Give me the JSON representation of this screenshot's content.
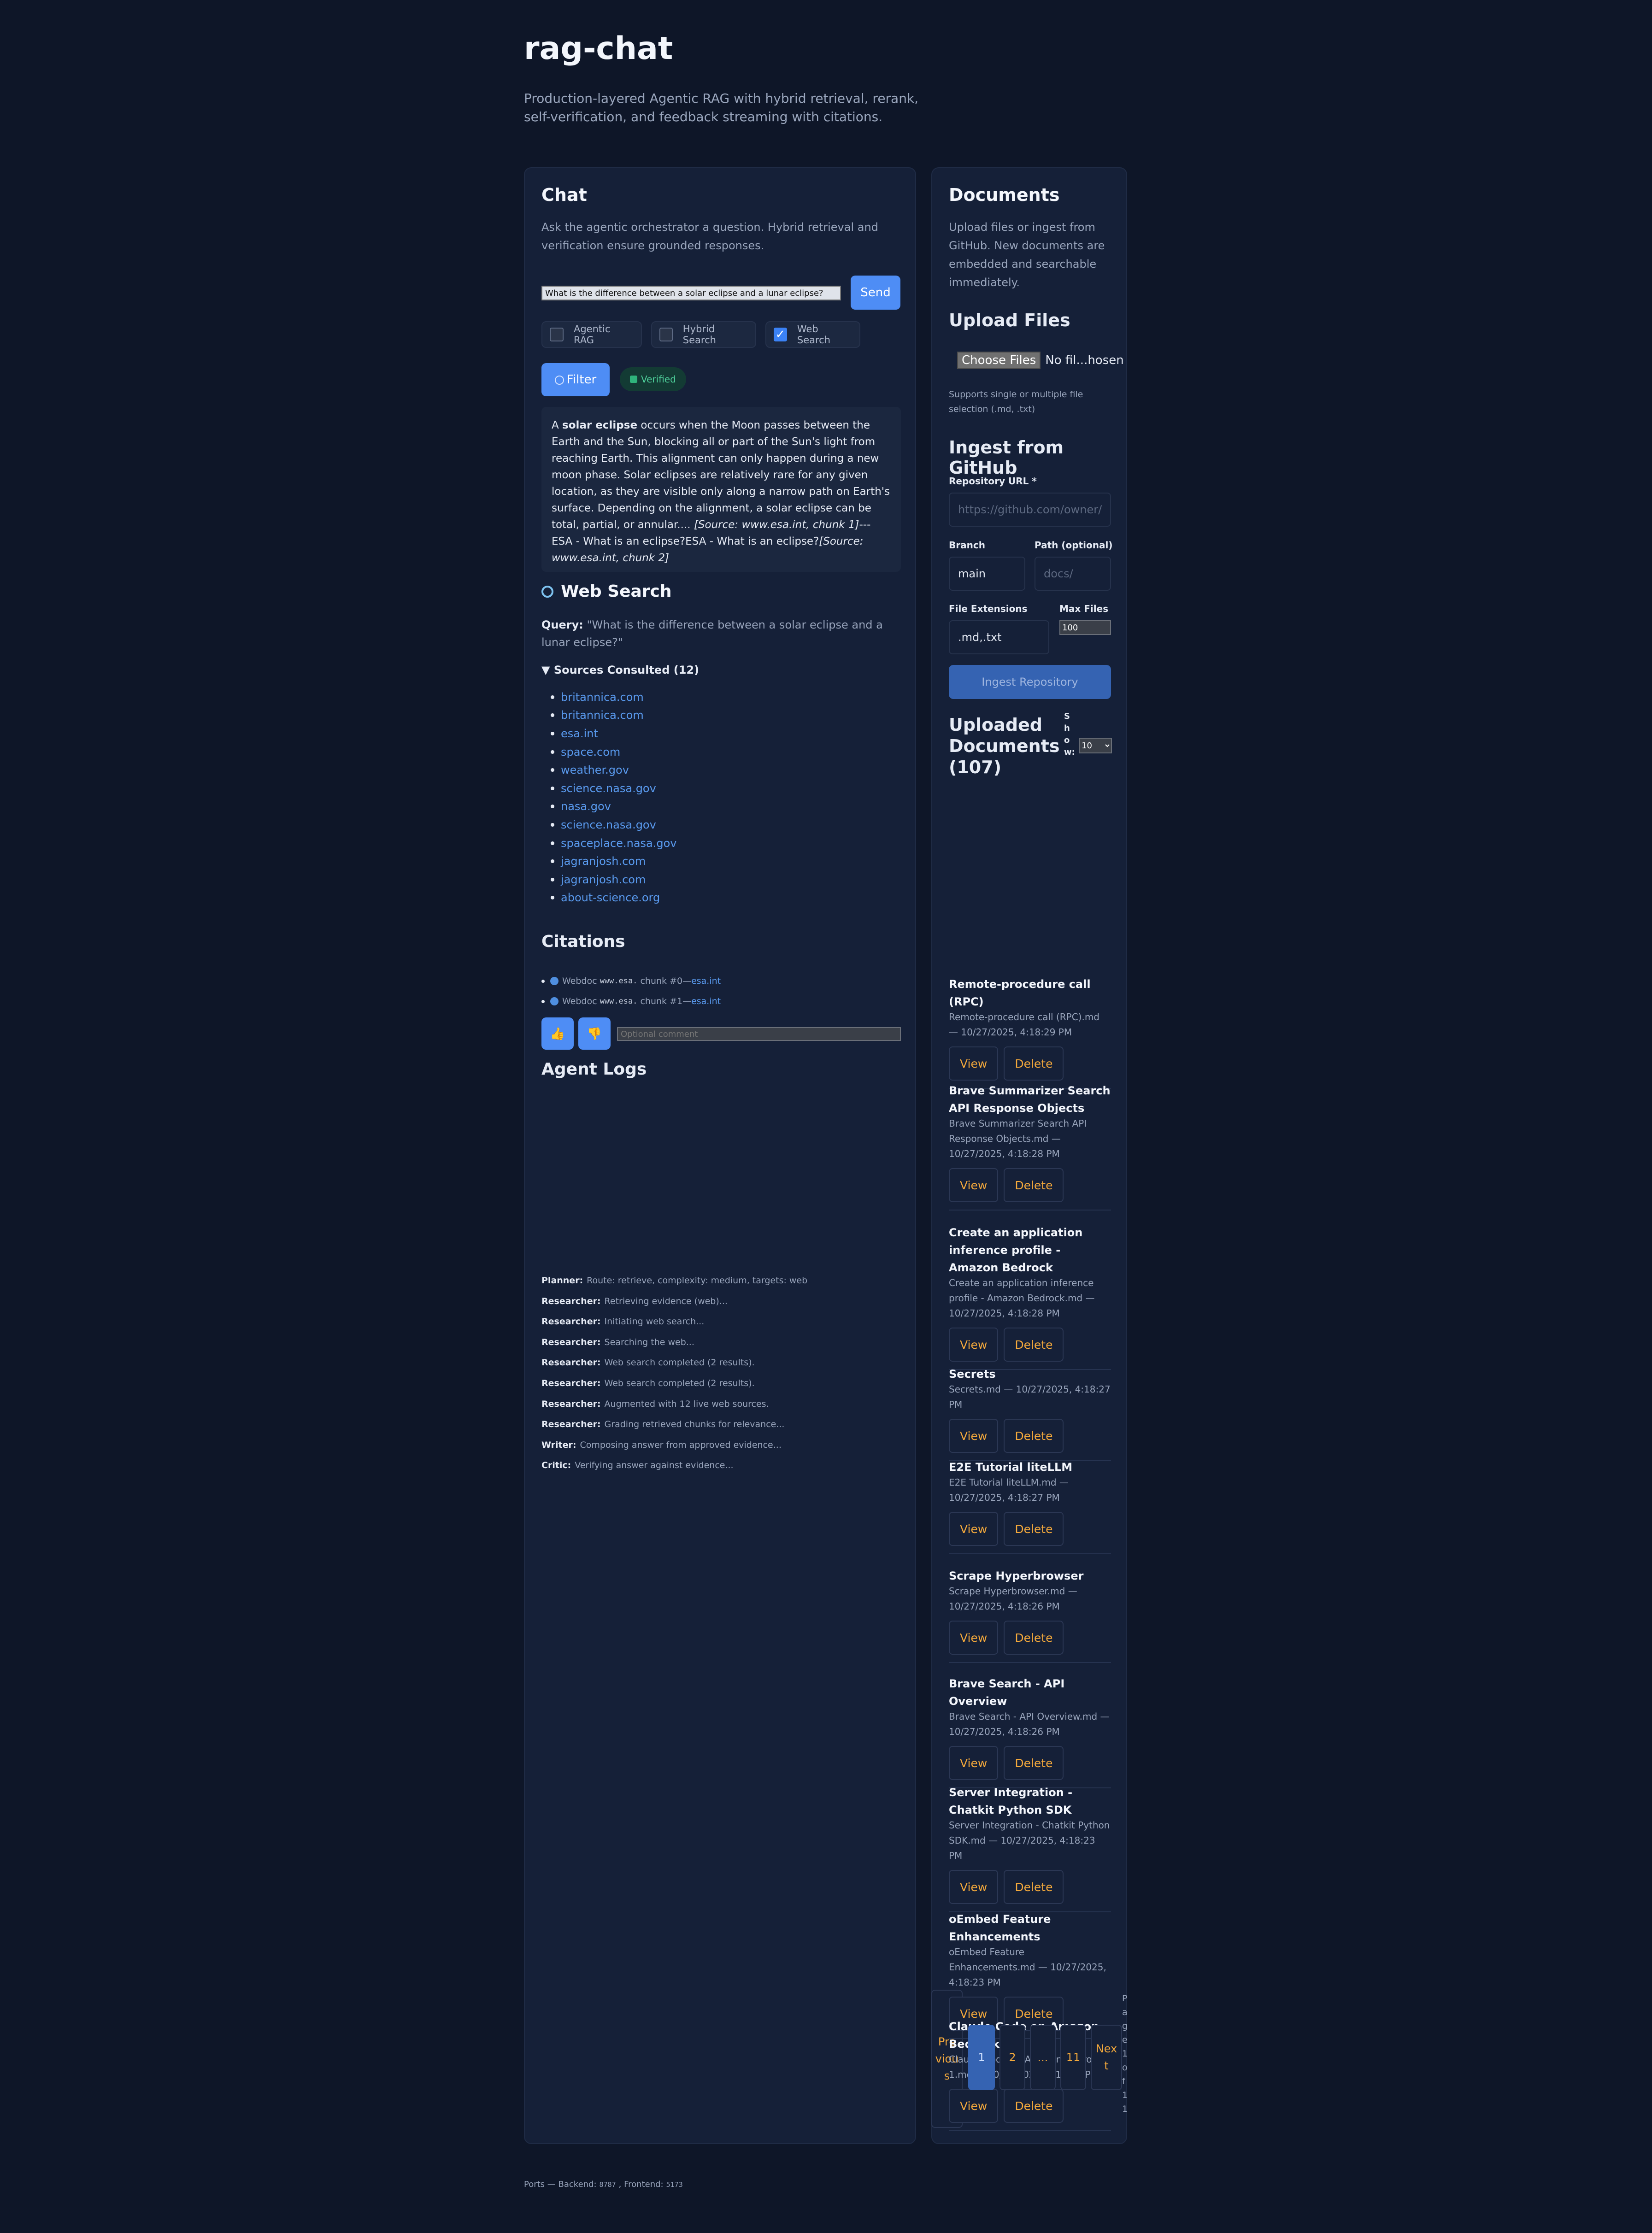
{
  "app": {
    "title": "rag-chat",
    "subtitle": "Production-layered Agentic RAG with hybrid retrieval, rerank, self-verification, and feedback streaming with citations."
  },
  "chat": {
    "heading": "Chat",
    "description": "Ask the agentic orchestrator a question. Hybrid retrieval and verification ensure grounded responses.",
    "query_value": "What is the difference between a solar eclipse and a lunar eclipse?",
    "send_label": "Send",
    "toggles": [
      {
        "label": "Agentic RAG",
        "checked": false
      },
      {
        "label": "Hybrid Search",
        "checked": false
      },
      {
        "label": "Web Search",
        "checked": true
      }
    ],
    "filter_label": "Filter",
    "verified_label": "Verified",
    "answer": {
      "prefix": "A ",
      "bold": "solar eclipse",
      "body": " occurs when the Moon passes between the Earth and the Sun, blocking all or part of the Sun's light from reaching Earth. This alignment can only happen during a new moon phase. Solar eclipses are relatively rare for any given location, as they are visible only along a narrow path on Earth's surface. Depending on the alignment, a solar eclipse can be total, partial, or annular....",
      "cite1": "[Source: www.esa.int, chunk 1]",
      "mid": "---ESA - What is an eclipse?ESA - What is an eclipse?",
      "cite2": "[Source: www.esa.int, chunk 2]"
    }
  },
  "web_search": {
    "heading": "Web Search",
    "query_label": "Query:",
    "query_text": "\"What is the difference between a solar eclipse and a lunar eclipse?\"",
    "sources_summary": "▼ Sources Consulted (12)",
    "sources": [
      "britannica.com",
      "britannica.com",
      "esa.int",
      "space.com",
      "weather.gov",
      "science.nasa.gov",
      "nasa.gov",
      "science.nasa.gov",
      "spaceplace.nasa.gov",
      "jagranjosh.com",
      "jagranjosh.com",
      "about-science.org"
    ]
  },
  "citations": {
    "heading": "Citations",
    "items": [
      {
        "prefix": "Webdoc",
        "code": "www.esa.",
        "chunk": "chunk #0—",
        "link": "esa.int"
      },
      {
        "prefix": "Webdoc",
        "code": "www.esa.",
        "chunk": "chunk #1—",
        "link": "esa.int"
      }
    ],
    "comment_placeholder": "Optional comment"
  },
  "logs": {
    "heading": "Agent Logs",
    "entries": [
      {
        "agent": "Planner:",
        "text": "Route: retrieve, complexity: medium, targets: web"
      },
      {
        "agent": "Researcher:",
        "text": "Retrieving evidence (web)..."
      },
      {
        "agent": "Researcher:",
        "text": "Initiating web search..."
      },
      {
        "agent": "Researcher:",
        "text": "Searching the web..."
      },
      {
        "agent": "Researcher:",
        "text": "Web search completed (2 results)."
      },
      {
        "agent": "Researcher:",
        "text": "Web search completed (2 results)."
      },
      {
        "agent": "Researcher:",
        "text": "Augmented with 12 live web sources."
      },
      {
        "agent": "Researcher:",
        "text": "Grading retrieved chunks for relevance..."
      },
      {
        "agent": "Writer:",
        "text": "Composing answer from approved evidence..."
      },
      {
        "agent": "Critic:",
        "text": "Verifying answer against evidence..."
      }
    ]
  },
  "docs": {
    "heading": "Documents",
    "description": "Upload files or ingest from GitHub. New documents are embedded and searchable immediately.",
    "upload_heading": "Upload Files",
    "choose_label": "Choose Files",
    "no_file_label": "No fil...hosen",
    "upload_note": "Supports single or multiple file selection (.md, .txt)",
    "github_heading": "Ingest from GitHub",
    "repo_label": "Repository URL *",
    "repo_placeholder": "https://github.com/owner/repo",
    "branch_label": "Branch",
    "branch_value": "main",
    "path_label": "Path (optional)",
    "path_placeholder": "docs/",
    "ext_label": "File Extensions",
    "ext_value": ".md,.txt",
    "max_label": "Max Files",
    "max_value": "100",
    "ingest_label": "Ingest Repository",
    "uploaded_heading": "Uploaded Documents (107)",
    "show_label": "Show:",
    "show_value": "10",
    "view_label": "View",
    "delete_label": "Delete",
    "items": [
      {
        "title": "Remote-procedure call (RPC)",
        "meta": "Remote-procedure call (RPC).md — 10/27/2025, 4:18:29 PM"
      },
      {
        "title": "Brave Summarizer Search API Response Objects",
        "meta": "Brave Summarizer Search API Response Objects.md — 10/27/2025, 4:18:28 PM"
      },
      {
        "title": "Create an application inference profile - Amazon Bedrock",
        "meta": "Create an application inference profile - Amazon Bedrock.md — 10/27/2025, 4:18:28 PM"
      },
      {
        "title": "Secrets",
        "meta": "Secrets.md — 10/27/2025, 4:18:27 PM"
      },
      {
        "title": "E2E Tutorial liteLLM",
        "meta": "E2E Tutorial liteLLM.md — 10/27/2025, 4:18:27 PM"
      },
      {
        "title": "Scrape Hyperbrowser",
        "meta": "Scrape Hyperbrowser.md — 10/27/2025, 4:18:26 PM"
      },
      {
        "title": "Brave Search - API Overview",
        "meta": "Brave Search - API Overview.md — 10/27/2025, 4:18:26 PM"
      },
      {
        "title": "Server Integration - Chatkit Python SDK",
        "meta": "Server Integration - Chatkit Python SDK.md — 10/27/2025, 4:18:23 PM"
      },
      {
        "title": "oEmbed Feature Enhancements",
        "meta": "oEmbed Feature Enhancements.md — 10/27/2025, 4:18:23 PM"
      },
      {
        "title": "Claude Code on Amazon Bedrock 1",
        "meta": "Claude Code on Amazon Bedrock 1.md — 10/27/2025, 4:18:22 PM"
      }
    ],
    "pagination": {
      "previous": "Previous",
      "pages": [
        "1",
        "2",
        "...",
        "11"
      ],
      "next": "Next",
      "info": "Page 1 of 11"
    }
  },
  "footer": {
    "prefix": "Ports — Backend:",
    "backend": "8787",
    "mid": ", Frontend:",
    "frontend": "5173"
  }
}
